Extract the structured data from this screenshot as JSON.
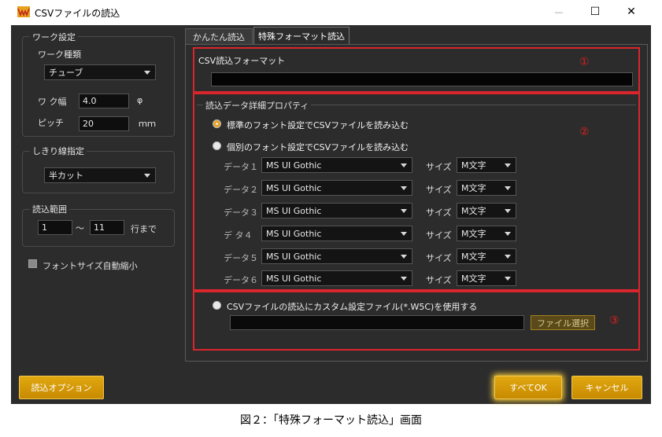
{
  "window": {
    "title": "CSVファイルの読込",
    "minimize": "—",
    "maximize": "☐",
    "close": "✕",
    "icon": "app-logo-icon"
  },
  "left": {
    "work_settings": {
      "title": "ワーク設定",
      "type_label": "ワーク種類",
      "type_value": "チューブ",
      "width_label": "ワ ク幅",
      "width_value": "4.0",
      "width_unit": "φ",
      "pitch_label": "ピッチ",
      "pitch_value": "20",
      "pitch_unit": "ｍｍ"
    },
    "divider": {
      "title": "しきり線指定",
      "value": "半カット"
    },
    "range": {
      "title": "読込範囲",
      "from": "1",
      "tilde": "〜",
      "to": "11",
      "suffix": "行まで"
    },
    "auto_shrink_label": "フォントサイズ自動縮小",
    "options_button": "読込オプション"
  },
  "tabs": [
    {
      "label": "かんたん読込"
    },
    {
      "label": "特殊フォーマット読込"
    }
  ],
  "format_section": {
    "title": "CSV読込フォーマット",
    "value": "",
    "marker": "①"
  },
  "props": {
    "title": "読込データ詳細プロパティ",
    "marker": "②",
    "radio_standard": "標準のフォント設定でCSVファイルを読み込む",
    "radio_individual": "個別のフォント設定でCSVファイルを読み込む",
    "size_label": "サイズ",
    "rows": [
      {
        "label": "データ１",
        "font": "MS UI Gothic",
        "size": "M文字"
      },
      {
        "label": "データ２",
        "font": "MS UI Gothic",
        "size": "M文字"
      },
      {
        "label": "データ３",
        "font": "MS UI Gothic",
        "size": "M文字"
      },
      {
        "label": "デ タ４",
        "font": "MS UI Gothic",
        "size": "M文字"
      },
      {
        "label": "データ５",
        "font": "MS UI Gothic",
        "size": "M文字"
      },
      {
        "label": "データ６",
        "font": "MS UI Gothic",
        "size": "M文字"
      }
    ]
  },
  "custom": {
    "radio_label": "CSVファイルの読込にカスタム設定ファイル(*.W5C)を使用する",
    "path_value": "",
    "select_button": "ファイル選択",
    "marker": "③"
  },
  "footer": {
    "ok_button": "すべてOK",
    "cancel_button": "キャンセル"
  },
  "caption": "図２：「特殊フォーマット読込」画面",
  "colors": {
    "dialog_bg": "#2c2c2c",
    "accent_gold": "#e0a810",
    "highlight_red": "#d9262c"
  }
}
